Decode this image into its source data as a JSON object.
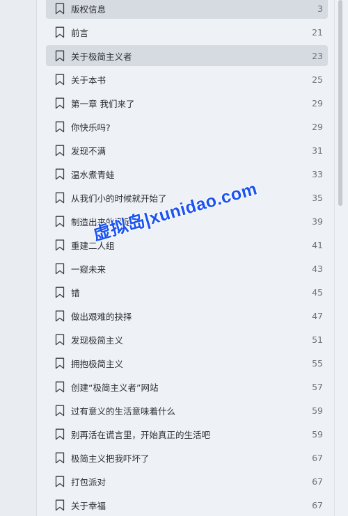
{
  "toc": {
    "items": [
      {
        "title": "版权信息",
        "page": "3",
        "highlighted": true
      },
      {
        "title": "前言",
        "page": "21"
      },
      {
        "title": "关于极简主义者",
        "page": "23",
        "highlighted": true
      },
      {
        "title": "关于本书",
        "page": "25"
      },
      {
        "title": "第一章 我们来了",
        "page": "29"
      },
      {
        "title": "你快乐吗?",
        "page": "29"
      },
      {
        "title": "发现不满",
        "page": "31"
      },
      {
        "title": "温水煮青蛙",
        "page": "33"
      },
      {
        "title": "从我们小的时候就开始了",
        "page": "35"
      },
      {
        "title": "制造出来的满足",
        "page": "39"
      },
      {
        "title": "重建二人组",
        "page": "41"
      },
      {
        "title": "一窥未来",
        "page": "43"
      },
      {
        "title": "错",
        "page": "45"
      },
      {
        "title": "做出艰难的抉择",
        "page": "47"
      },
      {
        "title": "发现极简主义",
        "page": "51"
      },
      {
        "title": "拥抱极简主义",
        "page": "55"
      },
      {
        "title": "创建“极简主义者”网站",
        "page": "57"
      },
      {
        "title": "过有意义的生活意味着什么",
        "page": "59"
      },
      {
        "title": "别再活在谎言里，开始真正的生活吧",
        "page": "59"
      },
      {
        "title": "极简主义把我吓坏了",
        "page": "67"
      },
      {
        "title": "打包派对",
        "page": "67"
      },
      {
        "title": "关于幸福",
        "page": "67"
      }
    ]
  },
  "watermark": {
    "text": "虚拟岛|xunidao.com"
  },
  "icons": {
    "bookmark": "bookmark-outline-icon"
  }
}
